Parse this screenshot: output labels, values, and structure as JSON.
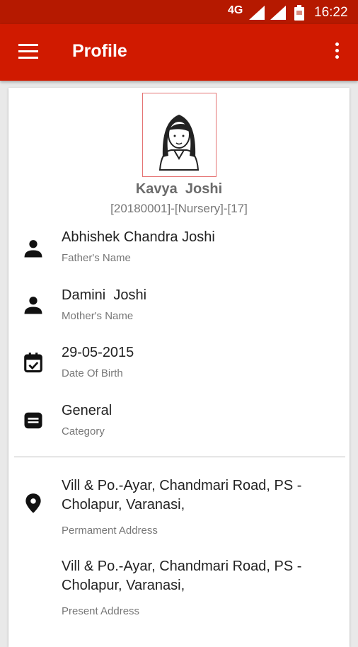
{
  "status_bar": {
    "network": "4G",
    "time": "16:22",
    "icons": [
      "signal-icon",
      "signal-icon",
      "battery-icon"
    ]
  },
  "toolbar": {
    "title": "Profile",
    "icons": [
      "hamburger-menu-icon",
      "more-vert-icon"
    ]
  },
  "profile": {
    "name": "Kavya  Joshi",
    "student_info": "[20180001]-[Nursery]-[17]",
    "fields": [
      {
        "icon": "person-icon",
        "value": "Abhishek Chandra Joshi",
        "label": "Father's Name"
      },
      {
        "icon": "person-icon",
        "value": "Damini  Joshi",
        "label": "Mother's Name"
      },
      {
        "icon": "calendar-check-icon",
        "value": "29-05-2015",
        "label": "Date Of Birth"
      },
      {
        "icon": "category-icon",
        "value": "General",
        "label": "Category"
      }
    ],
    "addresses": [
      {
        "icon": "location-pin-icon",
        "line1": "Vill & Po.-Ayar, Chandmari Road, PS -",
        "line2": "Cholapur, Varanasi,",
        "label": "Permament Address"
      },
      {
        "line1": "Vill & Po.-Ayar, Chandmari Road, PS -",
        "line2": "Cholapur, Varanasi,",
        "label": "Present Address"
      }
    ]
  },
  "colors": {
    "status_bar": "#b51900",
    "toolbar": "#d01a00",
    "photo_border": "#e57373"
  }
}
